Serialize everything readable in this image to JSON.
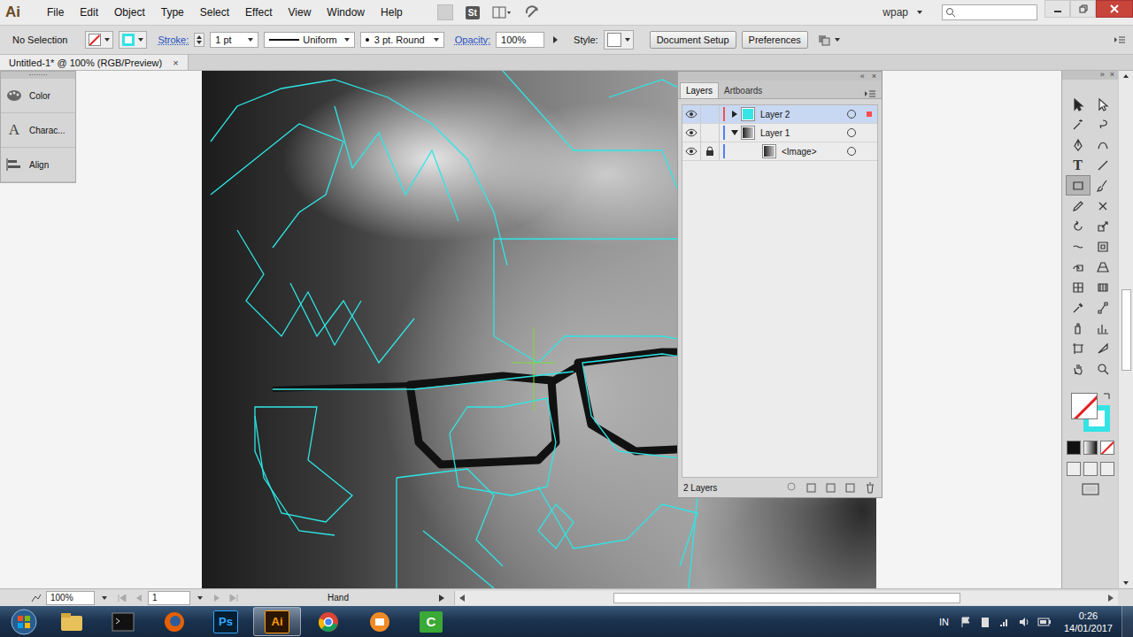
{
  "app_logo": "Ai",
  "menu": [
    "File",
    "Edit",
    "Object",
    "Type",
    "Select",
    "Effect",
    "View",
    "Window",
    "Help"
  ],
  "menubar_badges": [
    "St"
  ],
  "workspace": {
    "label": "wpap"
  },
  "search": {
    "value": ""
  },
  "control_bar": {
    "selection": "No Selection",
    "fill_none": true,
    "stroke_color": "#33e3e6",
    "stroke_label": "Stroke:",
    "stroke_weight": "1 pt",
    "profile": "Uniform",
    "brush": "3 pt. Round",
    "opacity_label": "Opacity:",
    "opacity": "100%",
    "style_label": "Style:",
    "buttons": [
      "Document Setup",
      "Preferences"
    ]
  },
  "document_tab": {
    "title": "Untitled-1* @ 100% (RGB/Preview)",
    "close": "×"
  },
  "collapsed_panels": [
    {
      "label": "Color",
      "kind": "color",
      "glyph": ""
    },
    {
      "label": "Charac...",
      "kind": "character",
      "glyph": "A"
    },
    {
      "label": "Align",
      "kind": "align",
      "glyph": ""
    }
  ],
  "layers_panel": {
    "tabs": [
      {
        "label": "Layers",
        "selected": true
      },
      {
        "label": "Artboards",
        "selected": false
      }
    ],
    "rows": [
      {
        "name": "Layer 2",
        "visible": true,
        "locked": false,
        "has_children": true,
        "expanded": false,
        "selected": true,
        "depth": 0,
        "color": "#ff4d4d",
        "thumbnail": "art"
      },
      {
        "name": "Layer 1",
        "visible": true,
        "locked": false,
        "has_children": true,
        "expanded": true,
        "selected": false,
        "depth": 0,
        "color": "#4f7fff",
        "thumbnail": "photo"
      },
      {
        "name": "<Image>",
        "visible": true,
        "locked": true,
        "has_children": false,
        "expanded": false,
        "selected": false,
        "depth": 1,
        "color": "#4f7fff",
        "thumbnail": "photo"
      }
    ],
    "footer": "2 Layers"
  },
  "tools": [
    {
      "selected": false
    },
    {
      "selected": false
    },
    {
      "selected": false
    },
    {
      "selected": false
    },
    {
      "selected": false
    },
    {
      "selected": false
    },
    {
      "selected": false,
      "glyph": "T"
    },
    {
      "selected": false
    },
    {
      "selected": true
    },
    {
      "selected": false
    },
    {
      "selected": false
    },
    {
      "selected": false
    },
    {
      "selected": false
    },
    {
      "selected": false
    },
    {
      "selected": false
    },
    {
      "selected": false
    },
    {
      "selected": false
    },
    {
      "selected": false
    },
    {
      "selected": false
    },
    {
      "selected": false
    },
    {
      "selected": false
    },
    {
      "selected": false
    },
    {
      "selected": false
    },
    {
      "selected": false
    },
    {
      "selected": false
    },
    {
      "selected": false
    },
    {
      "selected": false
    },
    {
      "selected": false
    }
  ],
  "swatches": {
    "fill_none": true,
    "stroke_color": "#33e3e6"
  },
  "status_bar": {
    "zoom": "100%",
    "artboard": "1",
    "tool": "Hand"
  },
  "taskbar": {
    "apps": [
      {
        "kind": "explorer",
        "glyph": "",
        "selected": false
      },
      {
        "kind": "cmd",
        "glyph": "",
        "selected": false
      },
      {
        "kind": "firefox",
        "glyph": "",
        "selected": false
      },
      {
        "kind": "photoshop",
        "glyph": "Ps",
        "selected": false
      },
      {
        "kind": "illustrator",
        "glyph": "Ai",
        "selected": true
      },
      {
        "kind": "chrome",
        "glyph": "",
        "selected": false
      },
      {
        "kind": "app",
        "glyph": "",
        "selected": false
      },
      {
        "kind": "camtasia",
        "glyph": "C",
        "selected": false
      }
    ],
    "language": "IN",
    "time": "0:26",
    "date": "14/01/2017"
  }
}
